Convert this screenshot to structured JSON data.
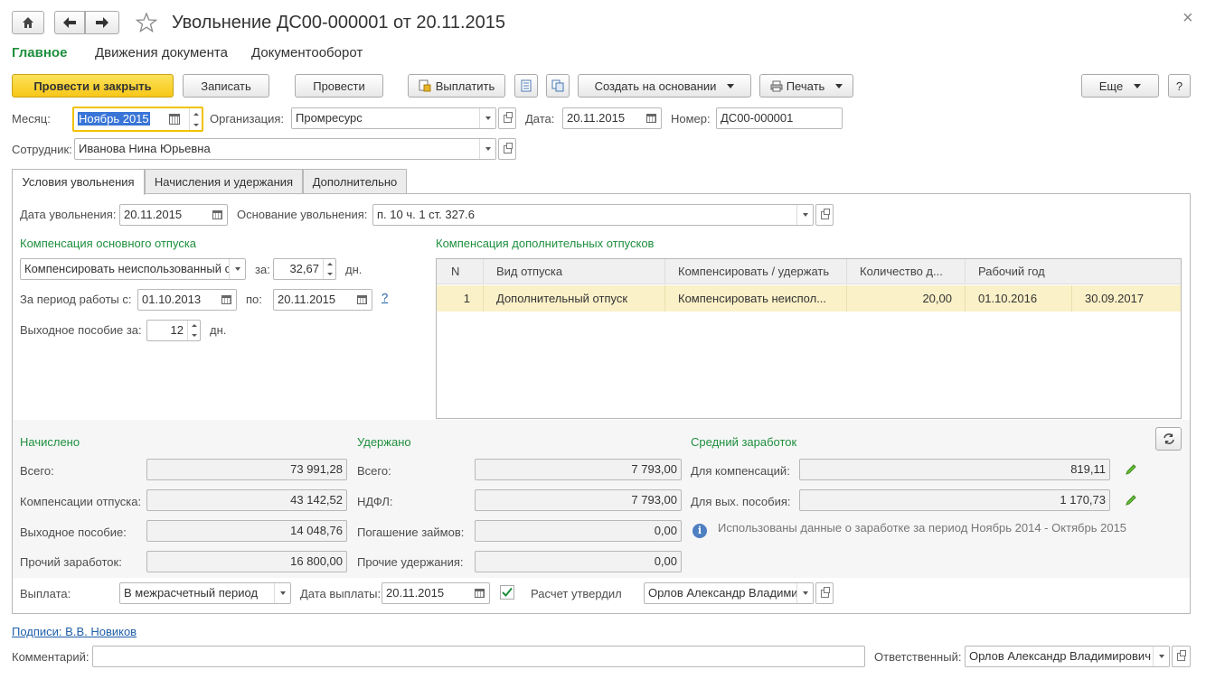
{
  "header": {
    "title": "Увольнение ДС00-000001 от 20.11.2015",
    "close": "×"
  },
  "nav": {
    "main": "Главное",
    "movements": "Движения документа",
    "docflow": "Документооборот"
  },
  "toolbar": {
    "post_close": "Провести и закрыть",
    "save": "Записать",
    "post": "Провести",
    "pay": "Выплатить",
    "create_based": "Создать на основании",
    "print": "Печать",
    "more": "Еще",
    "help": "?"
  },
  "form": {
    "month_label": "Месяц:",
    "month_value": "Ноябрь 2015",
    "org_label": "Организация:",
    "org_value": "Промресурс",
    "date_label": "Дата:",
    "date_value": "20.11.2015",
    "number_label": "Номер:",
    "number_value": "ДС00-000001",
    "employee_label": "Сотрудник:",
    "employee_value": "Иванова Нина Юрьевна"
  },
  "tabs": [
    "Условия увольнения",
    "Начисления и удержания",
    "Дополнительно"
  ],
  "conditions": {
    "dismissal_date_label": "Дата увольнения:",
    "dismissal_date_value": "20.11.2015",
    "reason_label": "Основание увольнения:",
    "reason_value": "п. 10 ч. 1 ст. 327.6",
    "main_comp_title": "Компенсация основного отпуска",
    "comp_mode_value": "Компенсировать неиспользованный о",
    "for_label": "за:",
    "days_value": "32,67",
    "days_unit": "дн.",
    "period_from_label": "За период работы с:",
    "period_from_value": "01.10.2013",
    "period_to_label": "по:",
    "period_to_value": "20.11.2015",
    "help_link": "?",
    "severance_label": "Выходное пособие за:",
    "severance_value": "12",
    "severance_unit": "дн.",
    "extra_comp_title": "Компенсация дополнительных отпусков"
  },
  "table": {
    "headers": [
      "N",
      "Вид отпуска",
      "Компенсировать / удержать",
      "Количество д...",
      "Рабочий год"
    ],
    "rows": [
      {
        "n": "1",
        "type": "Дополнительный отпуск",
        "mode": "Компенсировать неиспол...",
        "qty": "20,00",
        "from": "01.10.2016",
        "to": "30.09.2017"
      }
    ]
  },
  "accrued": {
    "title": "Начислено",
    "total_label": "Всего:",
    "total_value": "73 991,28",
    "vacation_label": "Компенсации отпуска:",
    "vacation_value": "43 142,52",
    "severance_label": "Выходное пособие:",
    "severance_value": "14 048,76",
    "other_label": "Прочий заработок:",
    "other_value": "16 800,00"
  },
  "withheld": {
    "title": "Удержано",
    "total_label": "Всего:",
    "total_value": "7 793,00",
    "ndfl_label": "НДФЛ:",
    "ndfl_value": "7 793,00",
    "loans_label": "Погашение займов:",
    "loans_value": "0,00",
    "other_label": "Прочие удержания:",
    "other_value": "0,00"
  },
  "average": {
    "title": "Средний заработок",
    "comp_label": "Для компенсаций:",
    "comp_value": "819,11",
    "sev_label": "Для вых. пособия:",
    "sev_value": "1 170,73",
    "info": "Использованы данные о заработке за период Ноябрь 2014 - Октябрь 2015"
  },
  "payment": {
    "label": "Выплата:",
    "value": "В межрасчетный период",
    "date_label": "Дата выплаты:",
    "date_value": "20.11.2015",
    "approved_label": "Расчет утвердил",
    "approved_value": "Орлов Александр Владими"
  },
  "footer": {
    "signatures": "Подписи: В.В. Новиков",
    "comment_label": "Комментарий:",
    "comment_value": "",
    "responsible_label": "Ответственный:",
    "responsible_value": "Орлов Александр Владимирович"
  },
  "colors": {
    "accent_green": "#1e8f3e",
    "primary_button": "#f7c718",
    "selected_row": "#fbf1c8",
    "link_blue": "#1f5fa8"
  }
}
